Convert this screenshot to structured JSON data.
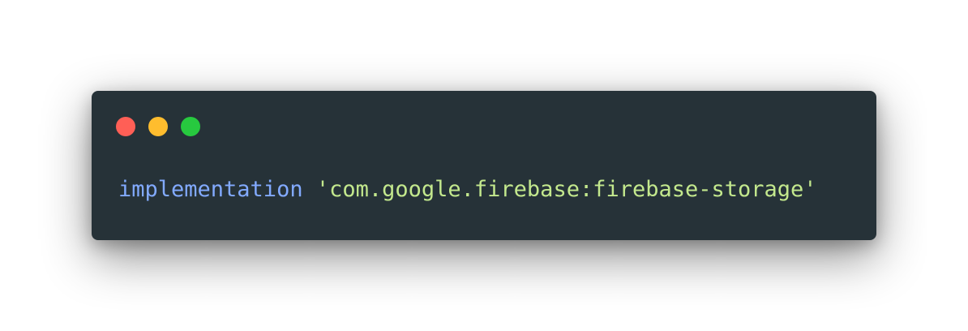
{
  "window": {
    "background_color": "#263238",
    "controls": [
      {
        "name": "close",
        "color": "#ff5f56"
      },
      {
        "name": "minimize",
        "color": "#ffbd2e"
      },
      {
        "name": "maximize",
        "color": "#27c93f"
      }
    ]
  },
  "code": {
    "keyword": "implementation",
    "space": " ",
    "string": "'com.google.firebase:firebase-storage'",
    "keyword_color": "#82aaff",
    "string_color": "#c3e88d"
  }
}
